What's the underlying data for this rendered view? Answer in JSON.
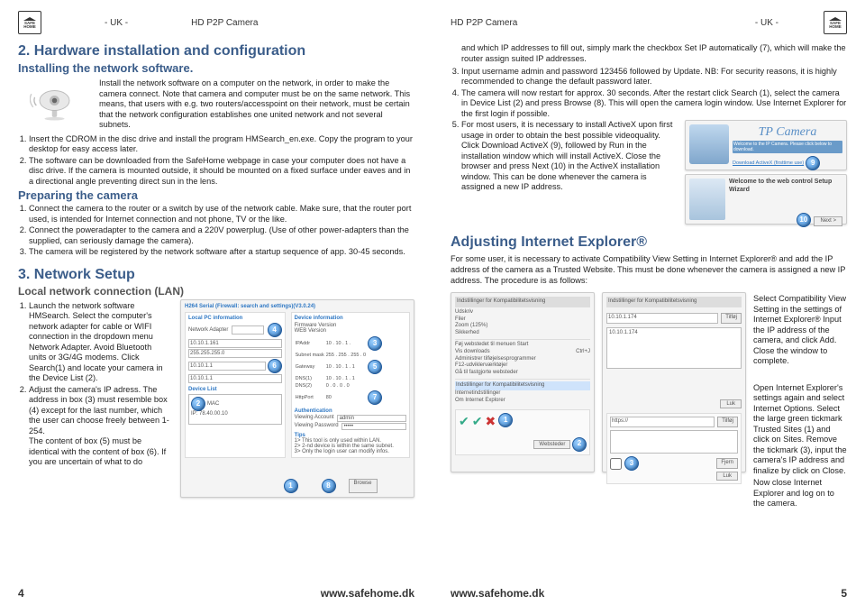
{
  "logo": {
    "line1": "SAFE",
    "line2": "HOME"
  },
  "top": {
    "uk": "- UK -",
    "product": "HD P2P Camera"
  },
  "left": {
    "h2": "2. Hardware installation and configuration",
    "h3a": "Installing the network software.",
    "intro": "Install the network software on a computer on the network, in order to make the camera connect. Note that camera and computer must be on the same network. This means, that users with e.g. two routers/accesspoint on their network, must be certain that the network configuration establishes one united network and not several subnets.",
    "li1": "Insert the CDROM in the disc drive and install the program HMSearch_en.exe. Copy the program to your desktop for easy access later.",
    "li2": "The software can be downloaded from the SafeHome webpage in case your computer does not have a disc drive. If the camera is mounted outside, it should be mounted on a fixed surface under eaves and in a directional angle preventing direct sun in the lens.",
    "h3b": "Preparing the camera",
    "p1": "Connect the camera to the router or a switch by use of the network cable. Make sure, that the router port used, is intended for Internet connection and not phone, TV or the like.",
    "p2": "Connect the poweradapter to the camera and a 220V powerplug. (Use of other power-adapters than the supplied, can seriously damage the camera).",
    "p3": "The camera will be registered by the network software after a startup sequence of app. 30-45 seconds.",
    "h2b": "3. Network Setup",
    "h3c": "Local network connection (LAN)",
    "n1": "Launch the network software HMSearch. Select the computer's network adapter for cable or WIFI connection in the dropdown menu Network Adapter. Avoid Bluetooth units or 3G/4G modems. Click Search(1) and locate your camera in the Device List (2).",
    "n2": "Adjust the camera's IP adress. The address in box (3) must resemble box (4) except for the last number, which the user can choose freely between 1-254.",
    "n2b": "The content of box (5) must be identical with the content of box (6). If you are uncertain of what to do",
    "shot_title": "H264 Serial (Firewall: search and settings)(V3.0.24)",
    "shot_local": "Local PC information",
    "shot_adapter": "Network Adapter",
    "shot_ip": "10.10.1.161",
    "shot_ip2": "255.255.255.0",
    "shot_ip3": "10.10.1.1",
    "shot_ip4": "10.10.1.1",
    "shot_devlist": "Device List",
    "shot_mac": "MAC",
    "shot_dev_ip": "IP: 78.40.00.10",
    "shot_devhdr": "Device information",
    "shot_fw": "Firmware Version",
    "shot_web": "WEB Version",
    "shot_auth": "Authentication",
    "shot_view_acc": "Viewing Account",
    "shot_view_pwd": "Viewing Password",
    "shot_admin": "admin",
    "shot_tips": "Tips",
    "shot_tip1": "1> This tool is only used within LAN.",
    "shot_tip2": "2> 2-nd device is within the same subnet.",
    "shot_tip3": "3> Only the login user can modify infos.",
    "shot_browse": "Browse"
  },
  "right": {
    "cont": "and which IP addresses to fill out, simply mark the checkbox Set IP automatically (7), which will make the router assign suited IP addresses.",
    "li3": "Input username admin and password 123456 followed by Update. NB: For security reasons, it is highly recommended to change the default password later.",
    "li4": "The camera will now restart for approx. 30 seconds. After the restart click Search (1), select the camera in Device List (2) and press Browse (8). This will open the camera login window. Use Internet Explorer for the first login if possible.",
    "li5a": "For most users, it is necessary to install ActiveX upon first usage in order to obtain the best possible videoquality. Click Download ActiveX (9), followed by Run in the installation window which will install ActiveX. Close the browser and press Next (10) in the ActiveX installation window. This can be done whenever the camera is assigned a new IP address.",
    "tp_title": "TP Camera",
    "tp_sub1": "Welcome to the IP Camera. Please click below to download.",
    "tp_btn": "Download ActiveX (firsttime use)",
    "wiz_title": "Welcome to the web control Setup Wizard",
    "h2": "Adjusting Internet Explorer®",
    "adj_p": "For some user, it is necessary to activate Compatibility View Setting in Internet Explorer® and add the IP address of the camera as a Trusted Website. This must be done whenever the camera is assigned a new IP address. The procedure is as follows:",
    "col_r1": "Select Compatibility View Setting in the settings of Internet Explorer®    Input the IP address of the camera, and click Add. Close the window to complete.",
    "col_r2": "Open Internet Explorer's settings again and select Internet Options. Select the large green tickmark Trusted Sites (1) and click on Sites. Remove the tickmark (3), input the camera's IP address and finalize by click on Close.",
    "col_r3": "Now close Internet Explorer and log on to the camera.",
    "set_title": "Indstillinger for Kompatibilitetsvisning",
    "set_menu1": "Udskriv",
    "set_menu2": "Filer",
    "set_menu3": "Zoom (125%)",
    "set_menu4": "Sikkerhed",
    "set_menu5": "Føj webstedet til menuen Start",
    "set_menu6": "Vis downloads",
    "set_menu7": "Administrer tilføjelsesprogrammer",
    "set_menu8": "F12-udviklerværktøjer",
    "set_menu9": "Gå til fastgjorte websteder",
    "set_menu10": "Indstillinger for Kompatibilitetsvisning",
    "set_menu11": "Internetindstillinger",
    "set_menu12": "Om Internet Explorer",
    "set_hotkey": "Ctrl+J",
    "set_add": "Tilføj",
    "set_close": "Luk",
    "set_ip": "10.10.1.174",
    "set_ip2": "10.10.1.174",
    "set_webs": "Websteder",
    "set_fjern": "Fjern"
  },
  "footer": {
    "site": "www.safehome.dk",
    "p4": "4",
    "p5": "5"
  },
  "nums": {
    "n1": "1",
    "n2": "2",
    "n3": "3",
    "n4": "4",
    "n5": "5",
    "n6": "6",
    "n7": "7",
    "n8": "8",
    "n9": "9",
    "n10": "10"
  }
}
